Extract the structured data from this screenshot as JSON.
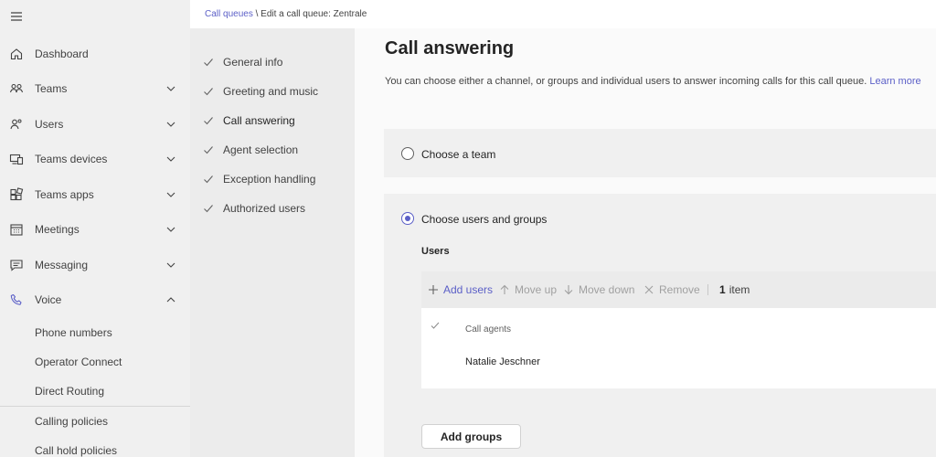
{
  "nav": {
    "items": [
      {
        "label": "Dashboard",
        "icon": "home-icon"
      },
      {
        "label": "Teams",
        "icon": "teams-icon"
      },
      {
        "label": "Users",
        "icon": "users-icon"
      },
      {
        "label": "Teams devices",
        "icon": "devices-icon"
      },
      {
        "label": "Teams apps",
        "icon": "apps-icon"
      },
      {
        "label": "Meetings",
        "icon": "calendar-icon"
      },
      {
        "label": "Messaging",
        "icon": "chat-icon"
      },
      {
        "label": "Voice",
        "icon": "phone-icon"
      }
    ],
    "voice_sub": [
      "Phone numbers",
      "Operator Connect",
      "Direct Routing",
      "Calling policies",
      "Call hold policies"
    ]
  },
  "breadcrumb": {
    "link": "Call queues",
    "separator": "\\",
    "current": "Edit a call queue: Zentrale"
  },
  "steps": [
    "General info",
    "Greeting and music",
    "Call answering",
    "Agent selection",
    "Exception handling",
    "Authorized users"
  ],
  "active_step": "Call answering",
  "main": {
    "title": "Call answering",
    "description": "You can choose either a channel, or groups and individual users to answer incoming calls for this call queue.",
    "learn_more": "Learn more",
    "option_team": "Choose a team",
    "option_users": "Choose users and groups",
    "selected_option": "Choose users and groups",
    "users_heading": "Users",
    "toolbar": {
      "add_users": "Add users",
      "move_up": "Move up",
      "move_down": "Move down",
      "remove": "Remove",
      "count_num": "1",
      "count_label": "item"
    },
    "table": {
      "column": "Call agents",
      "rows": [
        "Natalie Jeschner"
      ]
    },
    "add_groups": "Add groups"
  },
  "colors": {
    "accent": "#5b5fc7",
    "nav_bg": "#f0f0f0",
    "steps_bg": "#ececec"
  }
}
